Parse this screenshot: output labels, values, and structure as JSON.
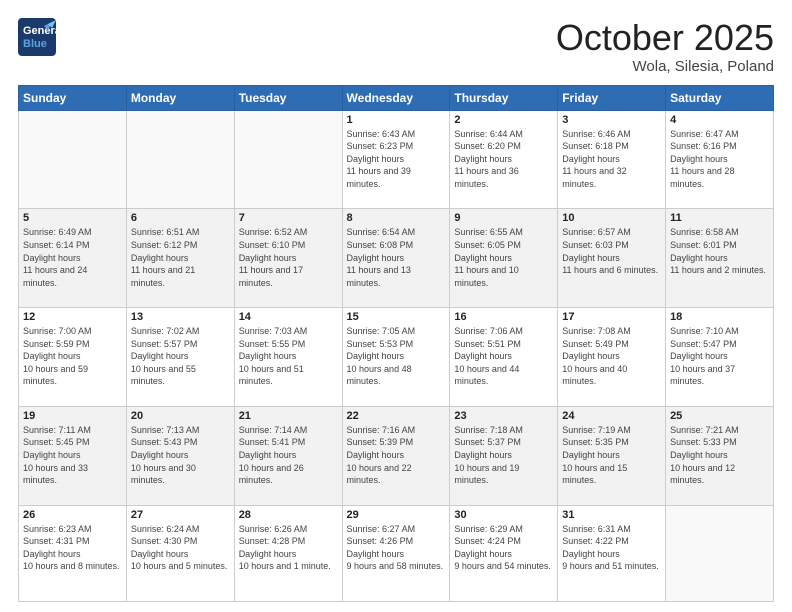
{
  "header": {
    "logo_general": "General",
    "logo_blue": "Blue",
    "month_title": "October 2025",
    "location": "Wola, Silesia, Poland"
  },
  "days_of_week": [
    "Sunday",
    "Monday",
    "Tuesday",
    "Wednesday",
    "Thursday",
    "Friday",
    "Saturday"
  ],
  "weeks": [
    [
      {
        "day": "",
        "sunrise": "",
        "sunset": "",
        "daylight": ""
      },
      {
        "day": "",
        "sunrise": "",
        "sunset": "",
        "daylight": ""
      },
      {
        "day": "",
        "sunrise": "",
        "sunset": "",
        "daylight": ""
      },
      {
        "day": "1",
        "sunrise": "6:43 AM",
        "sunset": "6:23 PM",
        "daylight": "11 hours and 39 minutes."
      },
      {
        "day": "2",
        "sunrise": "6:44 AM",
        "sunset": "6:20 PM",
        "daylight": "11 hours and 36 minutes."
      },
      {
        "day": "3",
        "sunrise": "6:46 AM",
        "sunset": "6:18 PM",
        "daylight": "11 hours and 32 minutes."
      },
      {
        "day": "4",
        "sunrise": "6:47 AM",
        "sunset": "6:16 PM",
        "daylight": "11 hours and 28 minutes."
      }
    ],
    [
      {
        "day": "5",
        "sunrise": "6:49 AM",
        "sunset": "6:14 PM",
        "daylight": "11 hours and 24 minutes."
      },
      {
        "day": "6",
        "sunrise": "6:51 AM",
        "sunset": "6:12 PM",
        "daylight": "11 hours and 21 minutes."
      },
      {
        "day": "7",
        "sunrise": "6:52 AM",
        "sunset": "6:10 PM",
        "daylight": "11 hours and 17 minutes."
      },
      {
        "day": "8",
        "sunrise": "6:54 AM",
        "sunset": "6:08 PM",
        "daylight": "11 hours and 13 minutes."
      },
      {
        "day": "9",
        "sunrise": "6:55 AM",
        "sunset": "6:05 PM",
        "daylight": "11 hours and 10 minutes."
      },
      {
        "day": "10",
        "sunrise": "6:57 AM",
        "sunset": "6:03 PM",
        "daylight": "11 hours and 6 minutes."
      },
      {
        "day": "11",
        "sunrise": "6:58 AM",
        "sunset": "6:01 PM",
        "daylight": "11 hours and 2 minutes."
      }
    ],
    [
      {
        "day": "12",
        "sunrise": "7:00 AM",
        "sunset": "5:59 PM",
        "daylight": "10 hours and 59 minutes."
      },
      {
        "day": "13",
        "sunrise": "7:02 AM",
        "sunset": "5:57 PM",
        "daylight": "10 hours and 55 minutes."
      },
      {
        "day": "14",
        "sunrise": "7:03 AM",
        "sunset": "5:55 PM",
        "daylight": "10 hours and 51 minutes."
      },
      {
        "day": "15",
        "sunrise": "7:05 AM",
        "sunset": "5:53 PM",
        "daylight": "10 hours and 48 minutes."
      },
      {
        "day": "16",
        "sunrise": "7:06 AM",
        "sunset": "5:51 PM",
        "daylight": "10 hours and 44 minutes."
      },
      {
        "day": "17",
        "sunrise": "7:08 AM",
        "sunset": "5:49 PM",
        "daylight": "10 hours and 40 minutes."
      },
      {
        "day": "18",
        "sunrise": "7:10 AM",
        "sunset": "5:47 PM",
        "daylight": "10 hours and 37 minutes."
      }
    ],
    [
      {
        "day": "19",
        "sunrise": "7:11 AM",
        "sunset": "5:45 PM",
        "daylight": "10 hours and 33 minutes."
      },
      {
        "day": "20",
        "sunrise": "7:13 AM",
        "sunset": "5:43 PM",
        "daylight": "10 hours and 30 minutes."
      },
      {
        "day": "21",
        "sunrise": "7:14 AM",
        "sunset": "5:41 PM",
        "daylight": "10 hours and 26 minutes."
      },
      {
        "day": "22",
        "sunrise": "7:16 AM",
        "sunset": "5:39 PM",
        "daylight": "10 hours and 22 minutes."
      },
      {
        "day": "23",
        "sunrise": "7:18 AM",
        "sunset": "5:37 PM",
        "daylight": "10 hours and 19 minutes."
      },
      {
        "day": "24",
        "sunrise": "7:19 AM",
        "sunset": "5:35 PM",
        "daylight": "10 hours and 15 minutes."
      },
      {
        "day": "25",
        "sunrise": "7:21 AM",
        "sunset": "5:33 PM",
        "daylight": "10 hours and 12 minutes."
      }
    ],
    [
      {
        "day": "26",
        "sunrise": "6:23 AM",
        "sunset": "4:31 PM",
        "daylight": "10 hours and 8 minutes."
      },
      {
        "day": "27",
        "sunrise": "6:24 AM",
        "sunset": "4:30 PM",
        "daylight": "10 hours and 5 minutes."
      },
      {
        "day": "28",
        "sunrise": "6:26 AM",
        "sunset": "4:28 PM",
        "daylight": "10 hours and 1 minute."
      },
      {
        "day": "29",
        "sunrise": "6:27 AM",
        "sunset": "4:26 PM",
        "daylight": "9 hours and 58 minutes."
      },
      {
        "day": "30",
        "sunrise": "6:29 AM",
        "sunset": "4:24 PM",
        "daylight": "9 hours and 54 minutes."
      },
      {
        "day": "31",
        "sunrise": "6:31 AM",
        "sunset": "4:22 PM",
        "daylight": "9 hours and 51 minutes."
      },
      {
        "day": "",
        "sunrise": "",
        "sunset": "",
        "daylight": ""
      }
    ]
  ],
  "labels": {
    "sunrise": "Sunrise:",
    "sunset": "Sunset:",
    "daylight": "Daylight:"
  }
}
